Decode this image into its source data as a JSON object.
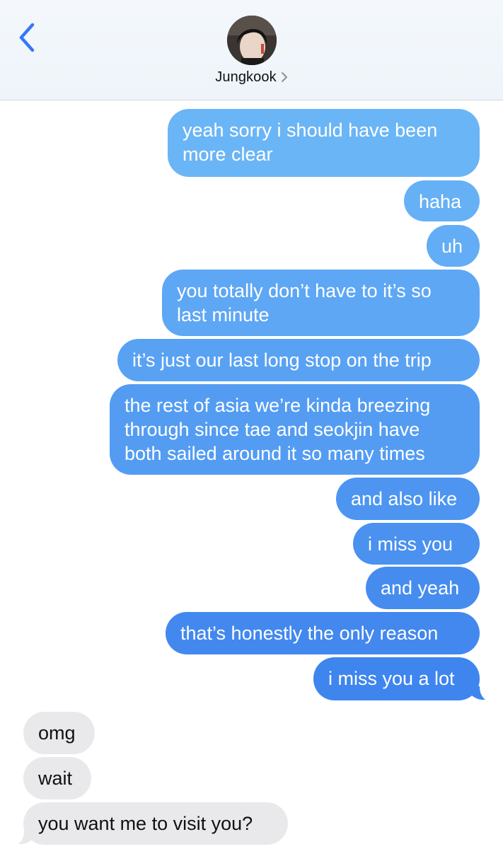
{
  "header": {
    "contact_name": "Jungkook",
    "back_icon": "chevron-left-icon",
    "detail_icon": "chevron-right-icon",
    "accent_color": "#3478f6"
  },
  "messages": [
    {
      "direction": "sent",
      "text_lines": [
        "yeah sorry i should have been",
        "more clear"
      ]
    },
    {
      "direction": "sent",
      "text_lines": [
        "haha"
      ]
    },
    {
      "direction": "sent",
      "text_lines": [
        "uh"
      ]
    },
    {
      "direction": "sent",
      "text_lines": [
        "you totally don’t have to it’s so",
        "last minute"
      ]
    },
    {
      "direction": "sent",
      "text_lines": [
        "it’s just our last long stop on the trip"
      ]
    },
    {
      "direction": "sent",
      "text_lines": [
        "the rest of asia we’re kinda breezing",
        "through since tae and seokjin have",
        "both sailed around it so many times"
      ]
    },
    {
      "direction": "sent",
      "text_lines": [
        "and also like"
      ]
    },
    {
      "direction": "sent",
      "text_lines": [
        "i miss you"
      ]
    },
    {
      "direction": "sent",
      "text_lines": [
        "and yeah"
      ]
    },
    {
      "direction": "sent",
      "text_lines": [
        "that’s honestly the only reason"
      ]
    },
    {
      "direction": "sent",
      "text_lines": [
        "i miss you a lot"
      ]
    },
    {
      "direction": "received",
      "text_lines": [
        "omg"
      ]
    },
    {
      "direction": "received",
      "text_lines": [
        "wait"
      ]
    },
    {
      "direction": "received",
      "text_lines": [
        "you want me to visit you?"
      ]
    }
  ],
  "colors": {
    "sent_top": "#6bb6f6",
    "sent_bottom": "#3d86ef",
    "received_bg": "#e9e9eb"
  }
}
